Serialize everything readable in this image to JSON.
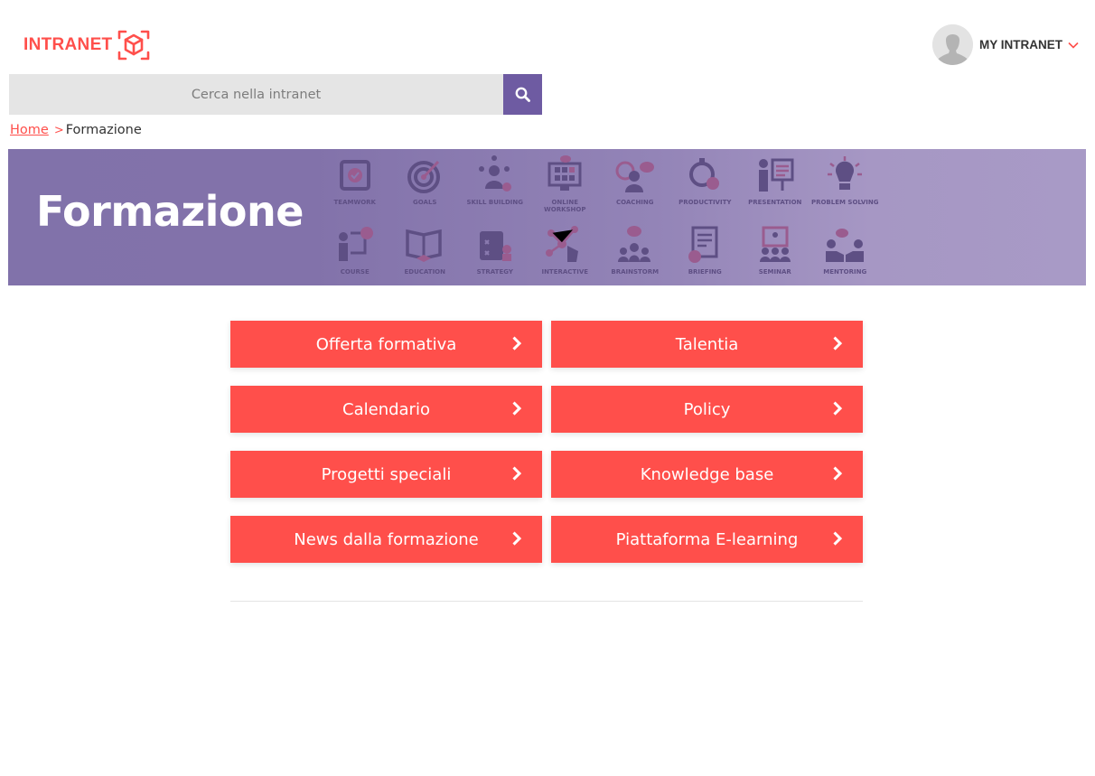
{
  "header": {
    "logo_text": "INTRANET",
    "logo_icon": "cube-icon",
    "user_menu_label": "MY INTRANET",
    "user_avatar": "user-silhouette-icon",
    "user_menu_icon": "chevron-down-icon"
  },
  "search": {
    "placeholder": "Cerca nella intranet",
    "value": "",
    "button_icon": "search-icon"
  },
  "breadcrumb": {
    "home": "Home",
    "separator": ">",
    "current": "Formazione"
  },
  "banner": {
    "title": "Formazione",
    "icons": [
      {
        "label": "TEAMWORK",
        "icon": "teamwork-icon"
      },
      {
        "label": "GOALS",
        "icon": "goals-icon"
      },
      {
        "label": "SKILL BUILDING",
        "icon": "skill-building-icon"
      },
      {
        "label": "ONLINE WORKSHOP",
        "icon": "online-workshop-icon"
      },
      {
        "label": "COACHING",
        "icon": "coaching-icon"
      },
      {
        "label": "PRODUCTIVITY",
        "icon": "productivity-icon"
      },
      {
        "label": "PRESENTATION",
        "icon": "presentation-icon"
      },
      {
        "label": "PROBLEM SOLVING",
        "icon": "problem-solving-icon"
      },
      {
        "label": "COURSE",
        "icon": "course-icon"
      },
      {
        "label": "EDUCATION",
        "icon": "education-icon"
      },
      {
        "label": "STRATEGY",
        "icon": "strategy-icon"
      },
      {
        "label": "INTERACTIVE",
        "icon": "interactive-icon"
      },
      {
        "label": "BRAINSTORM",
        "icon": "brainstorm-icon"
      },
      {
        "label": "BRIEFING",
        "icon": "briefing-icon"
      },
      {
        "label": "SEMINAR",
        "icon": "seminar-icon"
      },
      {
        "label": "MENTORING",
        "icon": "mentoring-icon"
      }
    ]
  },
  "tiles": [
    {
      "label": "Offerta formativa",
      "icon": "chevron-right-icon"
    },
    {
      "label": "Talentia",
      "icon": "chevron-right-icon"
    },
    {
      "label": "Calendario",
      "icon": "chevron-right-icon"
    },
    {
      "label": "Policy",
      "icon": "chevron-right-icon"
    },
    {
      "label": "Progetti speciali",
      "icon": "chevron-right-icon"
    },
    {
      "label": "Knowledge base",
      "icon": "chevron-right-icon"
    },
    {
      "label": "News dalla formazione",
      "icon": "chevron-right-icon"
    },
    {
      "label": "Piattaforma E-learning",
      "icon": "chevron-right-icon"
    }
  ],
  "colors": {
    "brand_red": "#ff4f4b",
    "accent_purple": "#6e5ba2",
    "banner_purple": "#8172aa",
    "search_bg": "#e5e5e5"
  }
}
